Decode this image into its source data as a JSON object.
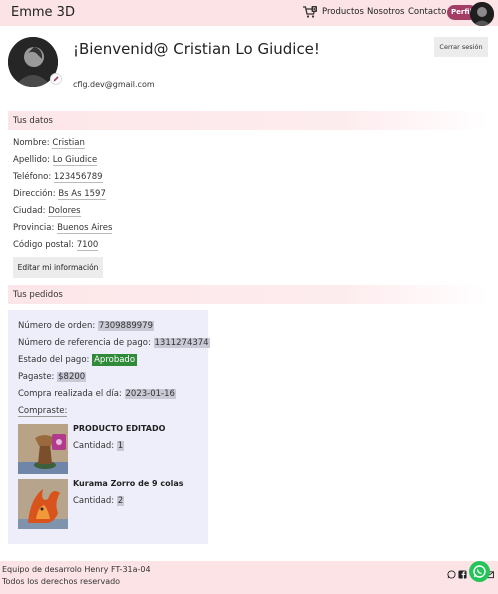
{
  "navbar": {
    "brand": "Emme 3D",
    "cart_count": "0",
    "links": [
      "Productos",
      "Nosotros",
      "Contacto"
    ],
    "profile_label": "Perfil"
  },
  "profile": {
    "welcome": "¡Bienvenid@ Cristian Lo Giudice!",
    "email": "cflg.dev@gmail.com",
    "logout_label": "Cerrar sesión"
  },
  "datos": {
    "title": "Tus datos",
    "fields": [
      {
        "label": "Nombre:",
        "value": "Cristian"
      },
      {
        "label": "Apellido:",
        "value": "Lo Giudice"
      },
      {
        "label": "Teléfono:",
        "value": "123456789"
      },
      {
        "label": "Dirección:",
        "value": "Bs As 1597"
      },
      {
        "label": "Ciudad:",
        "value": "Dolores"
      },
      {
        "label": "Provincia:",
        "value": "Buenos Aires"
      },
      {
        "label": "Código postal:",
        "value": "7100"
      }
    ],
    "edit_label": "Editar mi información"
  },
  "pedidos": {
    "title": "Tus pedidos",
    "order": {
      "order_number_label": "Número de orden:",
      "order_number": "7309889979",
      "payment_ref_label": "Número de referencia de pago:",
      "payment_ref": "1311274374",
      "status_label": "Estado del pago:",
      "status": "Aprobado",
      "paid_label": "Pagaste:",
      "paid": "$8200",
      "date_label": "Compra realizada el día:",
      "date": "2023-01-16",
      "bought_label": "Compraste:",
      "items": [
        {
          "name": "PRODUCTO EDITADO",
          "qty_label": "Cantidad:",
          "qty": "1"
        },
        {
          "name": "Kurama Zorro de 9 colas",
          "qty_label": "Cantidad:",
          "qty": "2"
        }
      ]
    }
  },
  "footer": {
    "line1": "Equipo de desarrolo Henry FT-31a-04",
    "line2": "Todos los derechos reservado"
  },
  "colors": {
    "navbar_bg": "#fbe3e6",
    "profile_pill": "#a33d64",
    "status_ok": "#2f8a3a",
    "order_card_bg": "#eeeefb",
    "whatsapp": "#25c45b"
  }
}
